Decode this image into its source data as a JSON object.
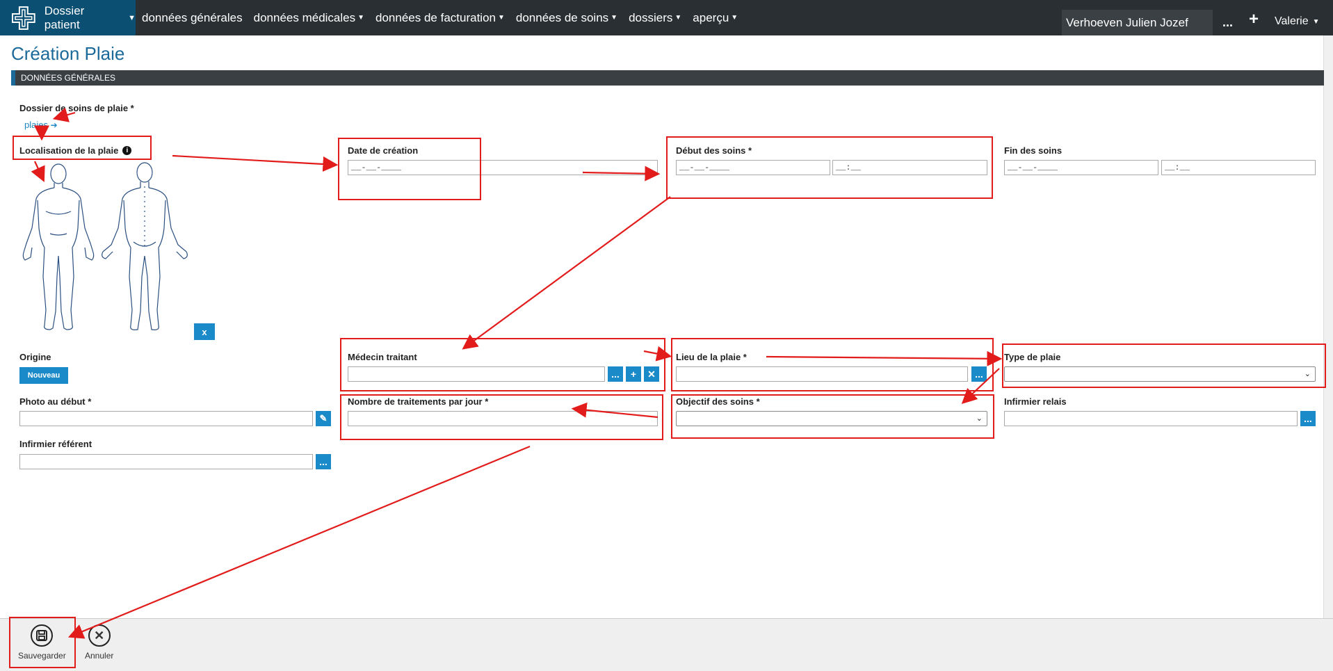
{
  "topbar": {
    "brand_label": "Dossier patient",
    "nav_items": [
      "données générales",
      "données médicales",
      "données de facturation",
      "données de soins",
      "dossiers",
      "aperçu"
    ],
    "patient_name": "Verhoeven Julien Jozef",
    "more_label": "...",
    "add_label": "+",
    "user_name": "Valerie"
  },
  "page": {
    "title": "Création Plaie",
    "section": "DONNÉES GÉNÉRALES"
  },
  "form": {
    "dossier_label": "Dossier de soins de plaie *",
    "dossier_link": "plaies",
    "localisation_label": "Localisation de la plaie",
    "body_clear": "x",
    "date_creation_label": "Date de création",
    "date_creation_value": "__-__-____",
    "debut_soins_label": "Début des soins *",
    "debut_soins_date": "__-__-____",
    "debut_soins_time": "__:__",
    "fin_soins_label": "Fin des soins",
    "fin_soins_date": "__-__-____",
    "fin_soins_time": "__:__",
    "origine_label": "Origine",
    "origine_button": "Nouveau",
    "medecin_label": "Médecin traitant",
    "lieu_label": "Lieu de la plaie *",
    "type_label": "Type de plaie",
    "photo_label": "Photo au début *",
    "nombre_label": "Nombre de traitements par jour *",
    "objectif_label": "Objectif des soins *",
    "relais_label": "Infirmier relais",
    "referent_label": "Infirmier référent",
    "ellipsis": "...",
    "plus": "+",
    "cross": "✕"
  },
  "actions": {
    "save": "Sauvegarder",
    "cancel": "Annuler"
  },
  "colors": {
    "accent": "#1a8ac9",
    "brand_bg": "#0b4f73",
    "topbar_bg": "#2a2f33",
    "annotation_red": "#e21b1b"
  }
}
